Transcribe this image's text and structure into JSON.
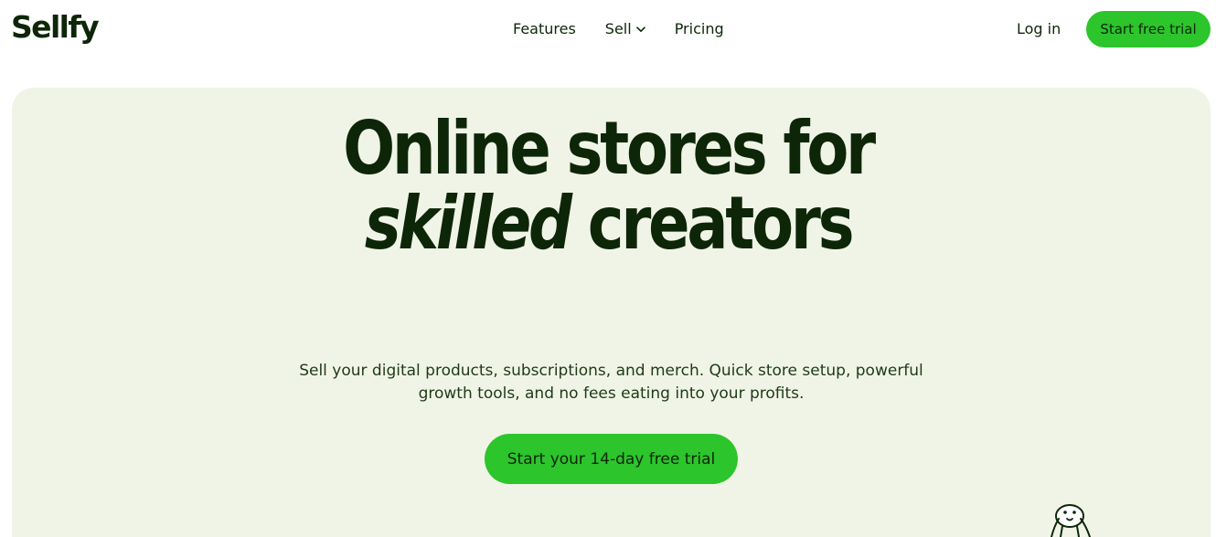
{
  "brand": {
    "logo_text": "Sellfy"
  },
  "nav": {
    "items": [
      {
        "label": "Features",
        "has_dropdown": false
      },
      {
        "label": "Sell",
        "has_dropdown": true
      },
      {
        "label": "Pricing",
        "has_dropdown": false
      }
    ],
    "login_label": "Log in",
    "trial_label": "Start free trial"
  },
  "hero": {
    "headline_line1": "Online stores for",
    "headline_em": "skilled",
    "headline_rest": " creators",
    "subtitle": "Sell your digital products, subscriptions, and merch. Quick store setup, powerful growth tools, and no fees eating into your profits.",
    "cta_label": "Start your 14-day free trial"
  },
  "colors": {
    "accent": "#2cc52c",
    "hero_background": "#f0f4e6",
    "text_dark": "#0d2608"
  },
  "icons": {
    "dropdown": "chevron-down-icon",
    "illustration": "creator-doodle-icon"
  }
}
